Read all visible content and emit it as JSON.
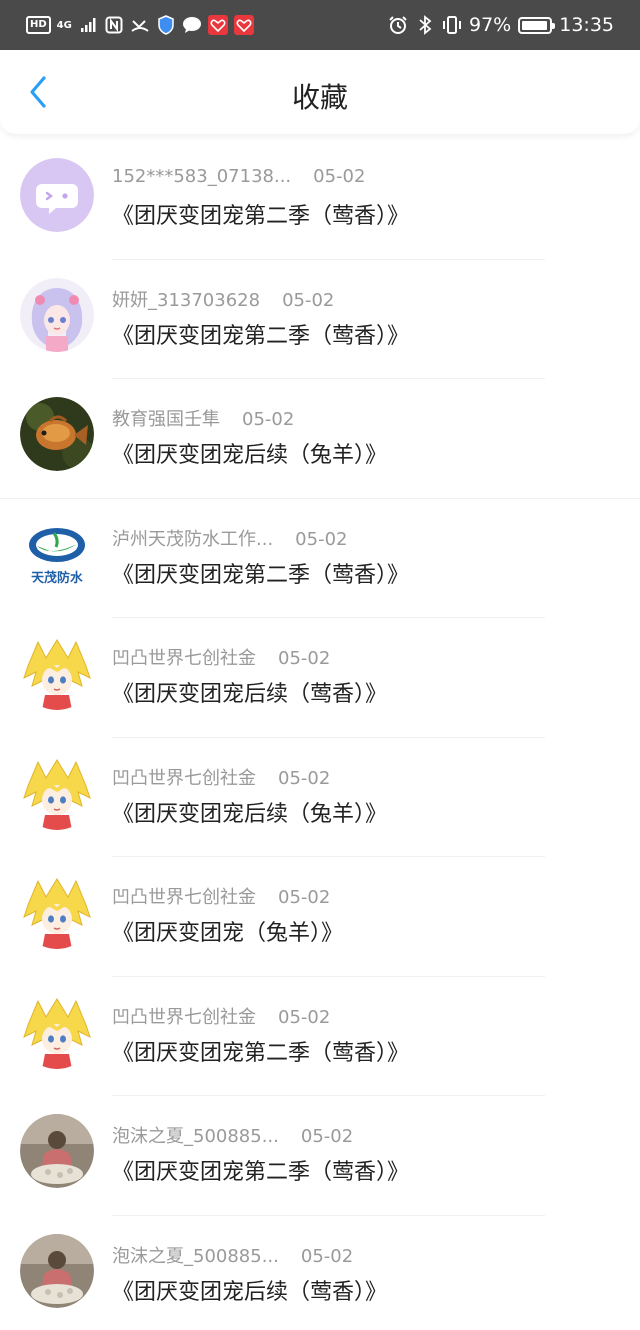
{
  "status_bar": {
    "hd_badge": "HD",
    "network": "4G",
    "battery_percent": "97%",
    "battery_level": 0.97,
    "time": "13:35"
  },
  "header": {
    "title": "收藏"
  },
  "items": [
    {
      "user": "152***583_07138...",
      "date": "05-02",
      "title": "《团厌变团宠第二季（莺香）》"
    },
    {
      "user": "妍妍_313703628",
      "date": "05-02",
      "title": "《团厌变团宠第二季（莺香）》"
    },
    {
      "user": "教育强国壬隼",
      "date": "05-02",
      "title": "《团厌变团宠后续（兔羊）》"
    },
    {
      "user": "泸州天茂防水工作...",
      "date": "05-02",
      "title": "《团厌变团宠第二季（莺香）》"
    },
    {
      "user": "凹凸世界七创社金",
      "date": "05-02",
      "title": "《团厌变团宠后续（莺香）》"
    },
    {
      "user": "凹凸世界七创社金",
      "date": "05-02",
      "title": "《团厌变团宠后续（兔羊）》"
    },
    {
      "user": "凹凸世界七创社金",
      "date": "05-02",
      "title": "《团厌变团宠（兔羊）》"
    },
    {
      "user": "凹凸世界七创社金",
      "date": "05-02",
      "title": "《团厌变团宠第二季（莺香）》"
    },
    {
      "user": "泡沫之夏_500885...",
      "date": "05-02",
      "title": "《团厌变团宠第二季（莺香）》"
    },
    {
      "user": "泡沫之夏_500885...",
      "date": "05-02",
      "title": "《团厌变团宠后续（莺香）》"
    }
  ],
  "avatar_logo_text": "天茂防水",
  "colors": {
    "accent": "#2a9ff5",
    "statusbar_bg": "#4a4a4a",
    "meta_text": "#9a9a9a",
    "title_text": "#222222"
  }
}
